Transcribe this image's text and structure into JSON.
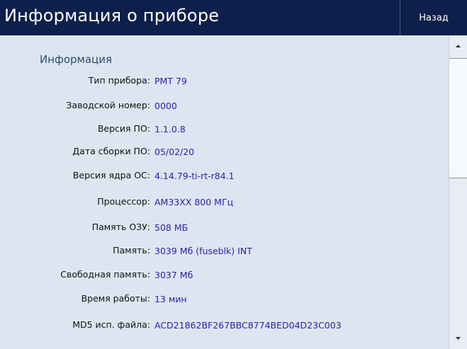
{
  "header": {
    "title": "Информация о приборе",
    "back_label": "Назад"
  },
  "section": {
    "title": "Информация"
  },
  "info": [
    {
      "label": "Тип прибора:",
      "value": "РМТ 79"
    },
    {
      "label": "Заводской номер:",
      "value": "0000"
    },
    {
      "label": "Версия ПО:",
      "value": "1.1.0.8"
    },
    {
      "label": "Дата сборки ПО:",
      "value": "05/02/20"
    },
    {
      "label": "Версия ядра ОС:",
      "value": "4.14.79-ti-rt-r84.1"
    },
    {
      "label": "Процессор:",
      "value": "AM33XX  800 МГц"
    },
    {
      "label": "Память ОЗУ:",
      "value": "508 МБ"
    },
    {
      "label": "Память:",
      "value": "3039 Мб (fuseblk) INT"
    },
    {
      "label": "Свободная память:",
      "value": "3037 Мб"
    },
    {
      "label": "Время работы:",
      "value": "13 мин"
    },
    {
      "label": "MD5 исп. файла:",
      "value": "ACD21862BF267BBC8774BED04D23C003"
    }
  ],
  "scrollbar": {
    "up_icon": "arrow-up-icon",
    "down_icon": "arrow-down-icon"
  },
  "colors": {
    "header_bg": "#0d1f4a",
    "page_bg": "#dbe6f0",
    "value_text": "#2a22a6",
    "section_title": "#2e4a6e"
  }
}
